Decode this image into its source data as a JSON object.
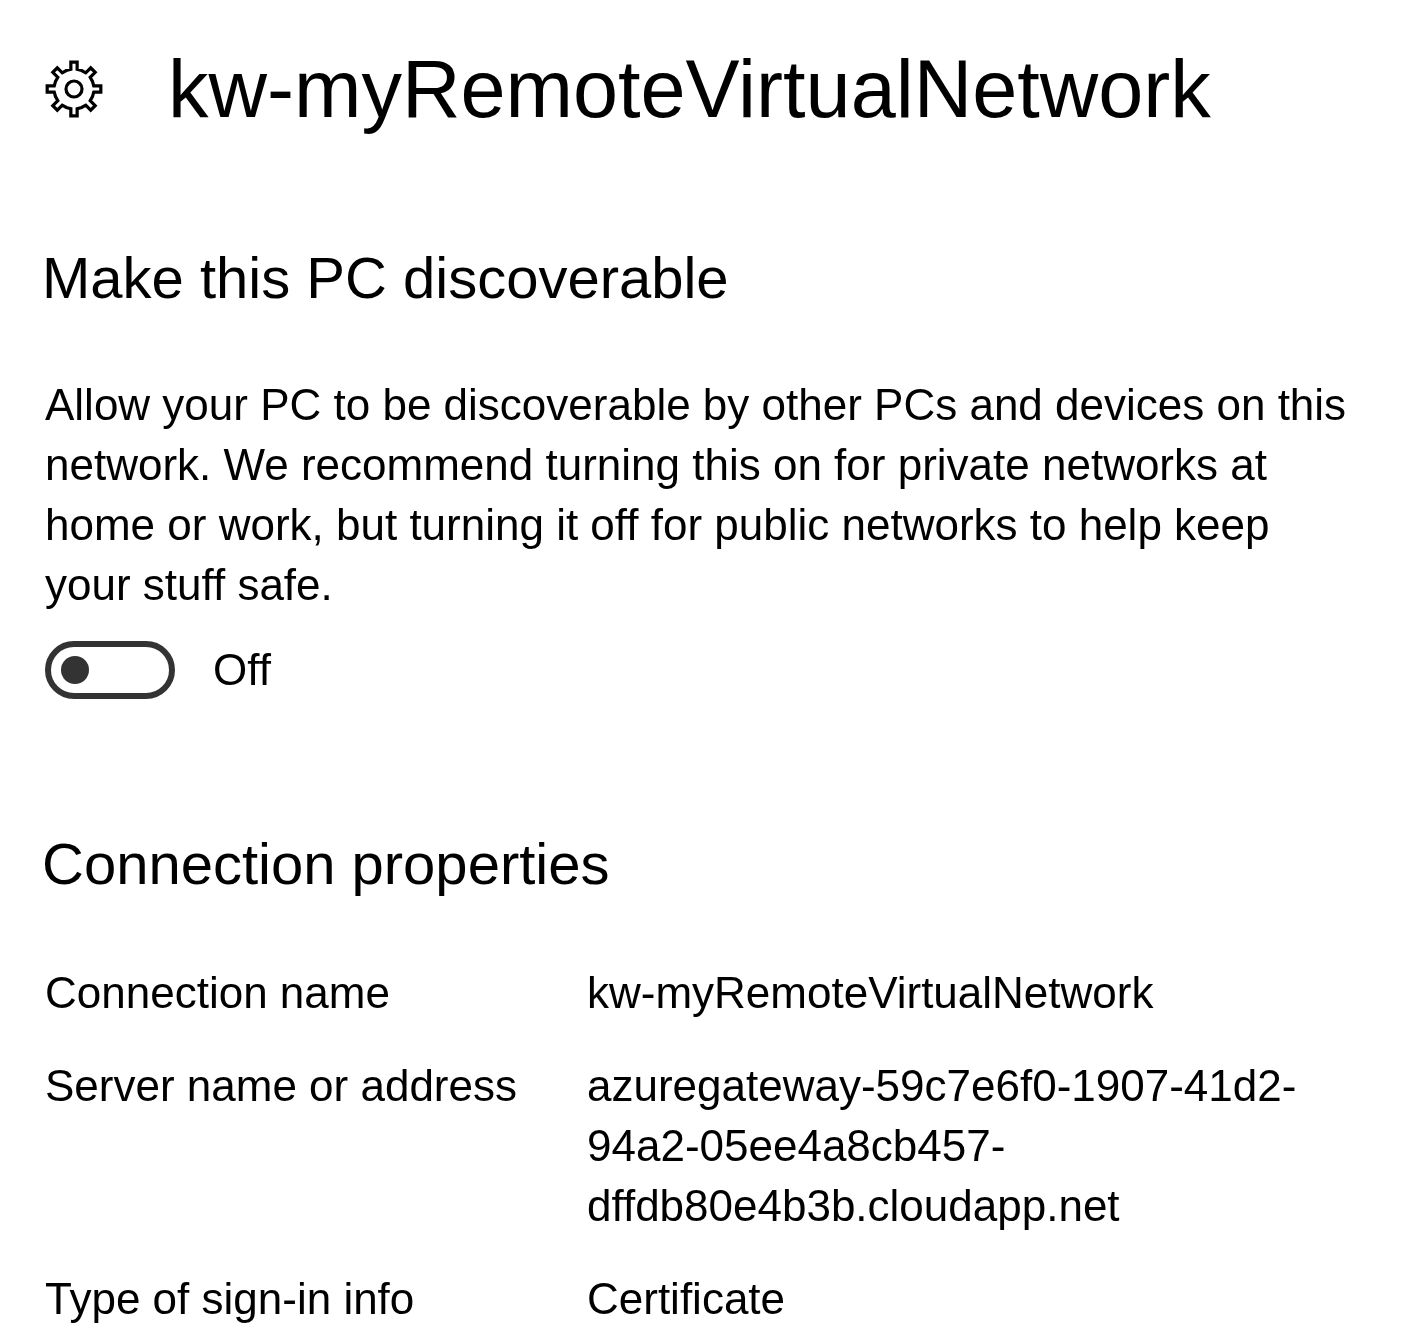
{
  "header": {
    "title": "kw-myRemoteVirtualNetwork"
  },
  "discoverable": {
    "heading": "Make this PC discoverable",
    "description": "Allow your PC to be discoverable by other PCs and devices on this network. We recommend turning this on for private networks at home or work, but turning it off for public networks to help keep your stuff safe.",
    "toggle": {
      "on": false,
      "label": "Off"
    }
  },
  "connection_properties": {
    "heading": "Connection properties",
    "rows": [
      {
        "label": "Connection name",
        "value": "kw-myRemoteVirtualNetwork"
      },
      {
        "label": "Server name or address",
        "value": "azuregateway-59c7e6f0-1907-41d2-94a2-05ee4a8cb457-dffdb80e4b3b.cloudapp.net"
      },
      {
        "label": "Type of sign-in info",
        "value": "Certificate"
      }
    ]
  }
}
